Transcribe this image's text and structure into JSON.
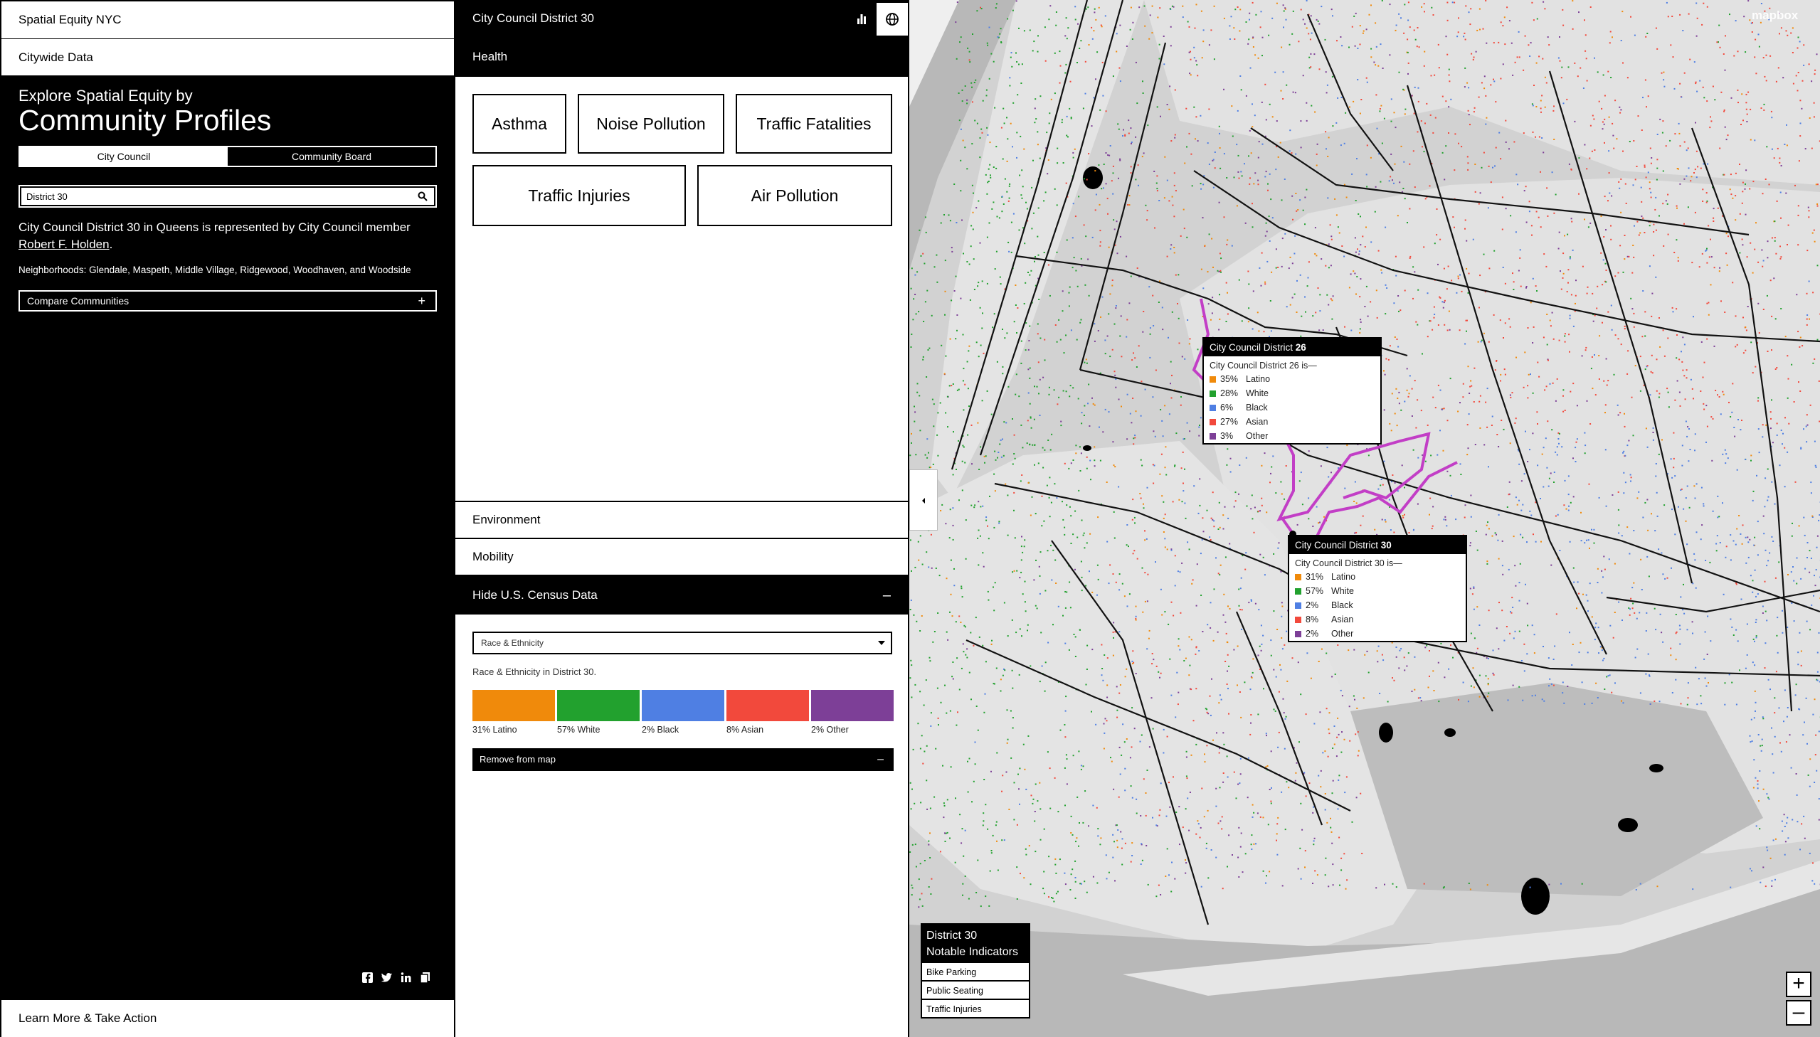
{
  "sidebar": {
    "site_title": "Spatial Equity NYC",
    "citywide": "Citywide Data",
    "explore_sub": "Explore Spatial Equity by",
    "explore_title": "Community Profiles",
    "toggle": {
      "city_council": "City Council",
      "community_board": "Community Board"
    },
    "search_value": "District 30",
    "desc_prefix": "City Council District 30 in Queens is represented by City Council member",
    "member_name": "Robert F. Holden",
    "desc_suffix": ".",
    "neighborhoods": "Neighborhoods: Glendale, Maspeth, Middle Village, Ridgewood, Woodhaven, and Woodside",
    "compare": "Compare Communities",
    "compare_icon": "+",
    "learn_more": "Learn More & Take Action"
  },
  "panel": {
    "title": "City Council District 30",
    "category": "Health",
    "indicators_row1": [
      "Asthma",
      "Noise Pollution",
      "Traffic Fatalities"
    ],
    "indicators_row2": [
      "Traffic Injuries",
      "Air Pollution"
    ],
    "environment": "Environment",
    "mobility": "Mobility",
    "census_toggle": "Hide U.S. Census Data",
    "census_icon": "–",
    "select_value": "Race & Ethnicity",
    "caption": "Race & Ethnicity in District 30.",
    "race": [
      {
        "label": "31% Latino",
        "color": "#f08a0b"
      },
      {
        "label": "57% White",
        "color": "#22a12e"
      },
      {
        "label": "2% Black",
        "color": "#4f7fe3"
      },
      {
        "label": "8% Asian",
        "color": "#f2493c"
      },
      {
        "label": "2% Other",
        "color": "#7d3f97"
      }
    ],
    "remove": "Remove from map",
    "remove_icon": "–"
  },
  "map": {
    "tooltip26": {
      "title_prefix": "City Council District ",
      "title_num": "26",
      "subtitle": "City Council District 26 is—",
      "rows": [
        {
          "pct": "35%",
          "label": "Latino",
          "color": "#f08a0b"
        },
        {
          "pct": "28%",
          "label": "White",
          "color": "#22a12e"
        },
        {
          "pct": "6%",
          "label": "Black",
          "color": "#4f7fe3"
        },
        {
          "pct": "27%",
          "label": "Asian",
          "color": "#f2493c"
        },
        {
          "pct": "3%",
          "label": "Other",
          "color": "#7d3f97"
        }
      ]
    },
    "tooltip30": {
      "title_prefix": "City Council District ",
      "title_num": "30",
      "subtitle": "City Council District 30 is—",
      "rows": [
        {
          "pct": "31%",
          "label": "Latino",
          "color": "#f08a0b"
        },
        {
          "pct": "57%",
          "label": "White",
          "color": "#22a12e"
        },
        {
          "pct": "2%",
          "label": "Black",
          "color": "#4f7fe3"
        },
        {
          "pct": "8%",
          "label": "Asian",
          "color": "#f2493c"
        },
        {
          "pct": "2%",
          "label": "Other",
          "color": "#7d3f97"
        }
      ]
    },
    "notable_title_1": "District 30",
    "notable_title_2": "Notable Indicators",
    "notable_items": [
      "Bike Parking",
      "Public Seating",
      "Traffic Injuries"
    ],
    "zoom_in": "+",
    "zoom_out": "–",
    "logo": "mapbox"
  }
}
